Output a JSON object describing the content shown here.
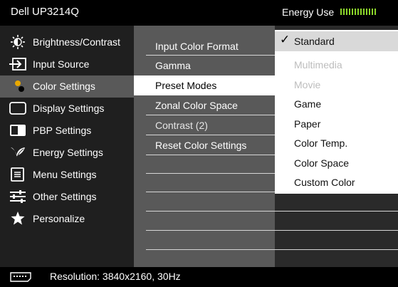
{
  "header": {
    "model": "Dell UP3214Q",
    "energy_label": "Energy Use",
    "energy_level_segments": 13,
    "energy_color": "#8bd62a"
  },
  "main_menu": {
    "selected": "Color Settings",
    "items": [
      {
        "label": "Brightness/Contrast",
        "icon": "brightness-icon"
      },
      {
        "label": "Input Source",
        "icon": "input-source-icon"
      },
      {
        "label": "Color Settings",
        "icon": "color-settings-icon"
      },
      {
        "label": "Display Settings",
        "icon": "display-settings-icon"
      },
      {
        "label": "PBP Settings",
        "icon": "pbp-icon"
      },
      {
        "label": "Energy Settings",
        "icon": "energy-icon"
      },
      {
        "label": "Menu Settings",
        "icon": "menu-settings-icon"
      },
      {
        "label": "Other Settings",
        "icon": "other-settings-icon"
      },
      {
        "label": "Personalize",
        "icon": "star-icon"
      }
    ]
  },
  "submenu": {
    "selected": "Preset Modes",
    "items": [
      {
        "label": "Input Color Format"
      },
      {
        "label": "Gamma"
      },
      {
        "label": "Preset Modes"
      },
      {
        "label": "Zonal Color Space"
      },
      {
        "label": "Contrast (2)"
      },
      {
        "label": "Reset Color Settings"
      }
    ]
  },
  "options": {
    "selected": "Standard",
    "items": [
      {
        "label": "Standard",
        "enabled": true
      },
      {
        "label": "Multimedia",
        "enabled": false
      },
      {
        "label": "Movie",
        "enabled": false
      },
      {
        "label": "Game",
        "enabled": true
      },
      {
        "label": "Paper",
        "enabled": true
      },
      {
        "label": "Color Temp.",
        "enabled": true
      },
      {
        "label": "Color Space",
        "enabled": true
      },
      {
        "label": "Custom Color",
        "enabled": true
      }
    ]
  },
  "footer": {
    "connector_icon": "displayport-icon",
    "resolution_text": "Resolution: 3840x2160, 30Hz"
  },
  "colors": {
    "header_bg": "#000000",
    "left_bg": "#1f1f1f",
    "selected_main_bg": "#595959",
    "submenu_bg": "#595959",
    "options_bg": "#ffffff"
  }
}
